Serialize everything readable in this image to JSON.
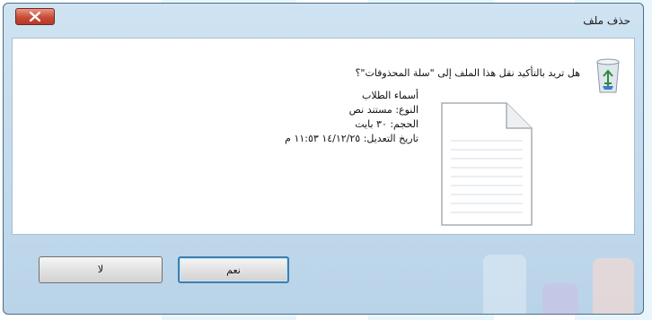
{
  "dialog": {
    "title": "حذف ملف",
    "question": "هل تريد بالتأكيد نقل هذا الملف إلى \"سلة المحذوفات\"؟",
    "details": {
      "name": "أسماء الطلاب",
      "type": "النوع: مستند نص",
      "size": "الحجم: ٣٠ بايت",
      "date": "تاريخ التعديل: ١٤/١٢/٢٥ ١١:٥٣ م"
    },
    "buttons": {
      "yes": "نعم",
      "no": "لا"
    }
  },
  "colors": {
    "frame": "#b9d3e8",
    "close_button": "#c94a36",
    "default_button_border": "#3c7fb1"
  },
  "icons": [
    "close-icon",
    "recycle-bin-icon",
    "text-file-icon"
  ]
}
